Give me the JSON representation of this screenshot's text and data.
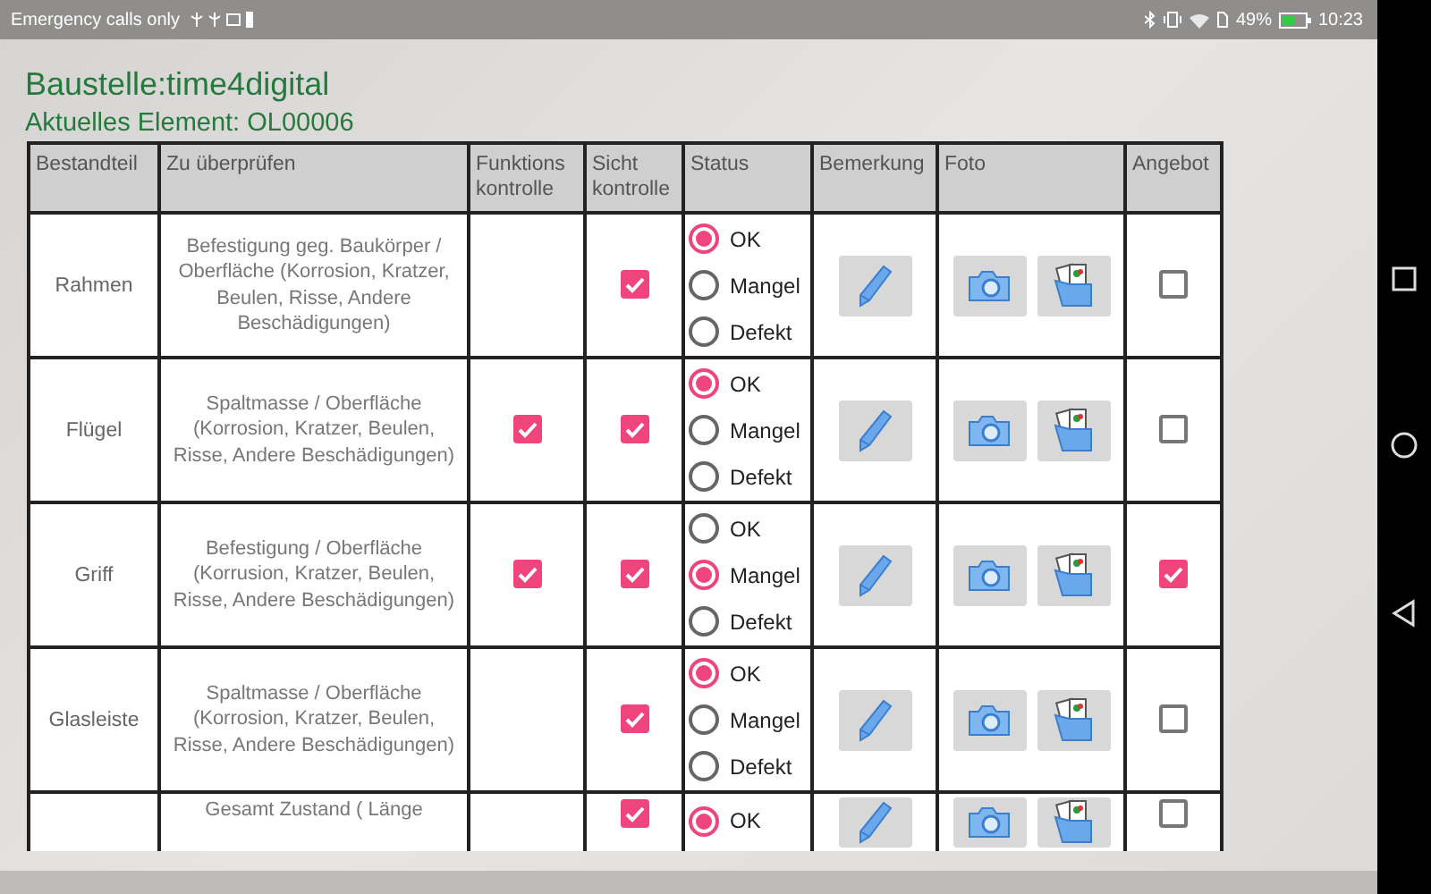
{
  "status_bar": {
    "carrier": "Emergency calls only",
    "battery": "49%",
    "time": "10:23"
  },
  "title": "Baustelle:time4digital",
  "subtitle": "Aktuelles Element: OL00006",
  "columns": [
    "Bestandteil",
    "Zu überprüfen",
    "Funktions kontrolle",
    "Sicht kontrolle",
    "Status",
    "Bemerkung",
    "Foto",
    "Angebot"
  ],
  "rows": [
    {
      "bestandteil": "Rahmen",
      "pruefen": "Befestigung geg. Baukörper / Oberfläche (Korrosion, Kratzer, Beulen, Risse, Andere Beschädigungen)",
      "funktion_checked": false,
      "sicht_checked": true,
      "status": [
        {
          "label": "OK",
          "selected": true
        },
        {
          "label": "Mangel",
          "selected": false
        },
        {
          "label": "Defekt",
          "selected": false
        }
      ],
      "angebot_checked": false
    },
    {
      "bestandteil": "Flügel",
      "pruefen": "Spaltmasse / Oberfläche (Korrosion, Kratzer, Beulen, Risse, Andere Beschädigungen)",
      "funktion_checked": true,
      "sicht_checked": true,
      "status": [
        {
          "label": "OK",
          "selected": true
        },
        {
          "label": "Mangel",
          "selected": false
        },
        {
          "label": "Defekt",
          "selected": false
        }
      ],
      "angebot_checked": false
    },
    {
      "bestandteil": "Griff",
      "pruefen": "Befestigung / Oberfläche (Korrusion, Kratzer, Beulen, Risse, Andere Beschädigungen)",
      "funktion_checked": true,
      "sicht_checked": true,
      "status": [
        {
          "label": "OK",
          "selected": false
        },
        {
          "label": "Mangel",
          "selected": true
        },
        {
          "label": "Defekt",
          "selected": false
        }
      ],
      "angebot_checked": true
    },
    {
      "bestandteil": "Glasleiste",
      "pruefen": "Spaltmasse / Oberfläche (Korrosion, Kratzer, Beulen, Risse, Andere Beschädigungen)",
      "funktion_checked": false,
      "sicht_checked": true,
      "status": [
        {
          "label": "OK",
          "selected": true
        },
        {
          "label": "Mangel",
          "selected": false
        },
        {
          "label": "Defekt",
          "selected": false
        }
      ],
      "angebot_checked": false
    },
    {
      "pruefen": "Gesamt Zustand ( Länge",
      "funktion_checked": false,
      "sicht_checked": true,
      "status": [
        {
          "label": "OK",
          "selected": true
        }
      ],
      "angebot_checked": false
    }
  ]
}
